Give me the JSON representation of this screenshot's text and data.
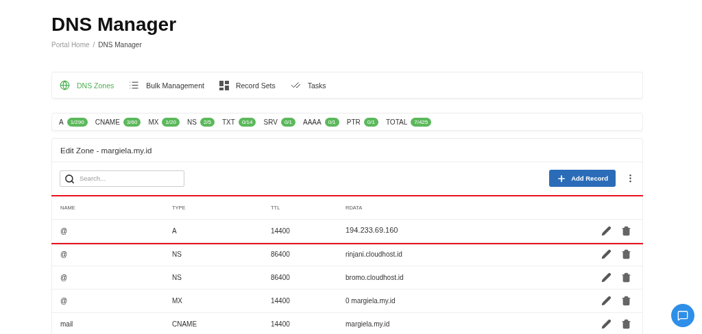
{
  "page": {
    "title": "DNS Manager"
  },
  "breadcrumb": {
    "separator": "/",
    "items": [
      {
        "label": "Portal Home",
        "current": false
      },
      {
        "label": "DNS Manager",
        "current": true
      }
    ]
  },
  "tabs": [
    {
      "label": "DNS Zones",
      "kind": "globe",
      "selected": true
    },
    {
      "label": "Bulk Management",
      "kind": "list",
      "selected": false
    },
    {
      "label": "Record Sets",
      "kind": "grid",
      "selected": false
    },
    {
      "label": "Tasks",
      "kind": "checks",
      "selected": false
    }
  ],
  "record_counts": [
    {
      "type": "A",
      "count": "1/290"
    },
    {
      "type": "CNAME",
      "count": "3/60"
    },
    {
      "type": "MX",
      "count": "1/20"
    },
    {
      "type": "NS",
      "count": "2/5"
    },
    {
      "type": "TXT",
      "count": "0/14"
    },
    {
      "type": "SRV",
      "count": "0/1"
    },
    {
      "type": "AAAA",
      "count": "0/1"
    },
    {
      "type": "PTR",
      "count": "0/1"
    },
    {
      "type": "TOTAL",
      "count": "7/425"
    }
  ],
  "zone": {
    "title": "Edit Zone - margiela.my.id",
    "search": {
      "placeholder": "Search..."
    },
    "add_button": "Add Record"
  },
  "table": {
    "columns": [
      "NAME",
      "TYPE",
      "TTL",
      "RDATA"
    ],
    "rows": [
      {
        "name": "@",
        "type": "A",
        "ttl": "14400",
        "rdata": "194.233.69.160",
        "highlighted": true
      },
      {
        "name": "@",
        "type": "NS",
        "ttl": "86400",
        "rdata": "rinjani.cloudhost.id",
        "highlighted": false
      },
      {
        "name": "@",
        "type": "NS",
        "ttl": "86400",
        "rdata": "bromo.cloudhost.id",
        "highlighted": false
      },
      {
        "name": "@",
        "type": "MX",
        "ttl": "14400",
        "rdata": "0 margiela.my.id",
        "highlighted": false
      },
      {
        "name": "mail",
        "type": "CNAME",
        "ttl": "14400",
        "rdata": "margiela.my.id",
        "highlighted": false
      }
    ]
  }
}
